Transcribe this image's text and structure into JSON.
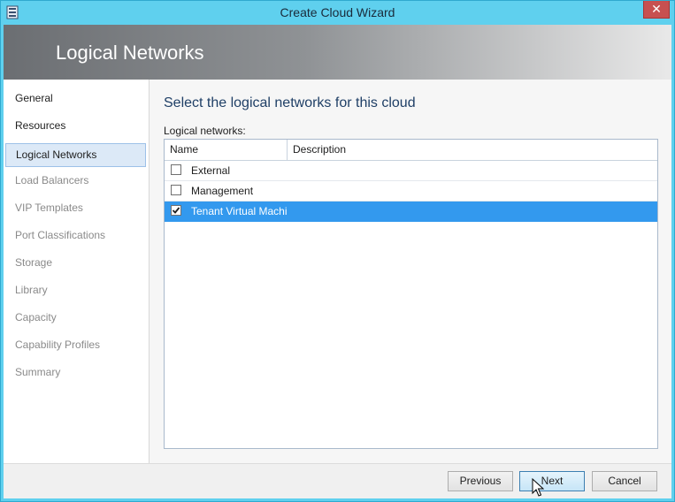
{
  "window": {
    "title": "Create Cloud Wizard",
    "close_label": "✕"
  },
  "banner": {
    "title": "Logical Networks"
  },
  "sidebar": {
    "items": [
      {
        "label": "General",
        "state": "normal"
      },
      {
        "label": "Resources",
        "state": "normal"
      },
      {
        "label": "Logical Networks",
        "state": "selected"
      },
      {
        "label": "Load Balancers",
        "state": "disabled"
      },
      {
        "label": "VIP Templates",
        "state": "disabled"
      },
      {
        "label": "Port Classifications",
        "state": "disabled"
      },
      {
        "label": "Storage",
        "state": "disabled"
      },
      {
        "label": "Library",
        "state": "disabled"
      },
      {
        "label": "Capacity",
        "state": "disabled"
      },
      {
        "label": "Capability Profiles",
        "state": "disabled"
      },
      {
        "label": "Summary",
        "state": "disabled"
      }
    ]
  },
  "main": {
    "heading": "Select the logical networks for this cloud",
    "list_label": "Logical networks:",
    "columns": {
      "name": "Name",
      "description": "Description"
    },
    "rows": [
      {
        "name": "External",
        "checked": false,
        "selected": false
      },
      {
        "name": "Management",
        "checked": false,
        "selected": false
      },
      {
        "name": "Tenant Virtual Machi",
        "checked": true,
        "selected": true
      }
    ]
  },
  "footer": {
    "previous_label": "Previous",
    "next_label": "Next",
    "cancel_label": "Cancel"
  },
  "colors": {
    "window_frame": "#5fd0ee",
    "selection": "#3399ee",
    "close_button": "#c75050",
    "heading_text": "#1f3f66"
  }
}
